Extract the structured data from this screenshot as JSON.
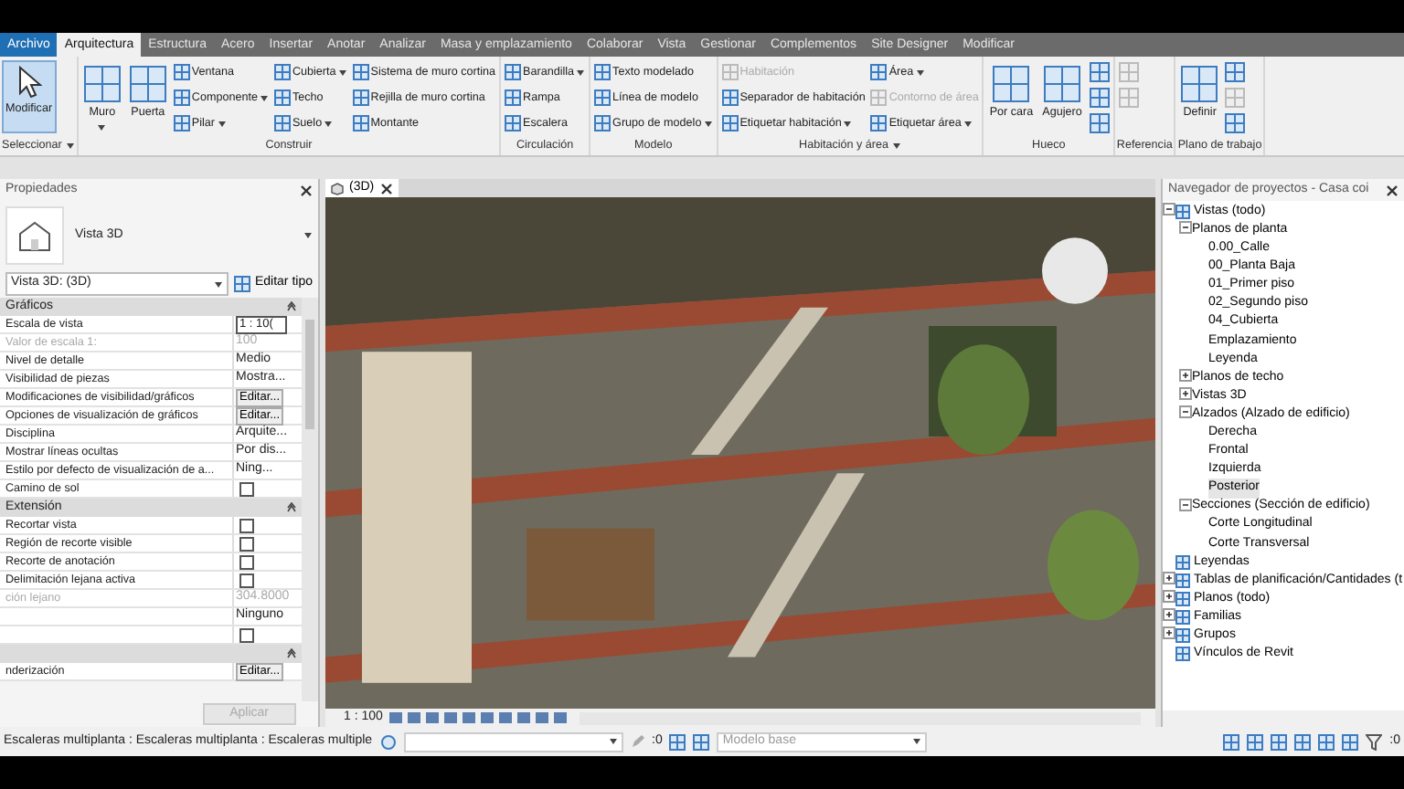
{
  "menu_tabs": [
    {
      "label": "Archivo",
      "kind": "file",
      "selected": false
    },
    {
      "label": "Arquitectura",
      "kind": "tab",
      "selected": true
    },
    {
      "label": "Estructura",
      "kind": "tab",
      "selected": false
    },
    {
      "label": "Acero",
      "kind": "tab",
      "selected": false
    },
    {
      "label": "Insertar",
      "kind": "tab",
      "selected": false
    },
    {
      "label": "Anotar",
      "kind": "tab",
      "selected": false
    },
    {
      "label": "Analizar",
      "kind": "tab",
      "selected": false
    },
    {
      "label": "Masa y emplazamiento",
      "kind": "tab",
      "selected": false
    },
    {
      "label": "Colaborar",
      "kind": "tab",
      "selected": false
    },
    {
      "label": "Vista",
      "kind": "tab",
      "selected": false
    },
    {
      "label": "Gestionar",
      "kind": "tab",
      "selected": false
    },
    {
      "label": "Complementos",
      "kind": "tab",
      "selected": false
    },
    {
      "label": "Site Designer",
      "kind": "tab",
      "selected": false
    },
    {
      "label": "Modificar",
      "kind": "tab",
      "selected": false
    }
  ],
  "ribbon": [
    {
      "title": "Seleccionar",
      "dropdown": true,
      "columns": [
        [
          {
            "label": "Modificar",
            "kind": "pointer",
            "pressed": true
          }
        ]
      ]
    },
    {
      "title": "Construir",
      "columns": [
        [
          {
            "label": "Muro",
            "kind": "large",
            "dropdown": true
          }
        ],
        [
          {
            "label": "Puerta",
            "kind": "large"
          }
        ],
        [
          {
            "label": "Ventana",
            "kind": "small"
          },
          {
            "label": "Componente",
            "kind": "small",
            "dropdown": true
          },
          {
            "label": "Pilar",
            "kind": "small",
            "dropdown": true
          }
        ],
        [
          {
            "label": "Cubierta",
            "kind": "small",
            "dropdown": true
          },
          {
            "label": "Techo",
            "kind": "small"
          },
          {
            "label": "Suelo",
            "kind": "small",
            "dropdown": true
          }
        ],
        [
          {
            "label": "Sistema de muro cortina",
            "kind": "small"
          },
          {
            "label": "Rejilla de muro cortina",
            "kind": "small"
          },
          {
            "label": "Montante",
            "kind": "small"
          }
        ]
      ]
    },
    {
      "title": "Circulación",
      "columns": [
        [
          {
            "label": "Barandilla",
            "kind": "small",
            "dropdown": true
          },
          {
            "label": "Rampa",
            "kind": "small"
          },
          {
            "label": "Escalera",
            "kind": "small"
          }
        ]
      ]
    },
    {
      "title": "Modelo",
      "columns": [
        [
          {
            "label": "Texto modelado",
            "kind": "small"
          },
          {
            "label": "Línea de modelo",
            "kind": "small"
          },
          {
            "label": "Grupo de modelo",
            "kind": "small",
            "dropdown": true
          }
        ]
      ]
    },
    {
      "title": "Habitación y área",
      "dropdown": true,
      "columns": [
        [
          {
            "label": "Habitación",
            "kind": "small",
            "disabled": true
          },
          {
            "label": "Separador de habitación",
            "kind": "small",
            "disabled": false
          },
          {
            "label": "Etiquetar habitación",
            "kind": "small",
            "dropdown": true,
            "disabled": false
          }
        ],
        [
          {
            "label": "Área",
            "kind": "small",
            "dropdown": true,
            "disabled": false
          },
          {
            "label": "Contorno de área",
            "kind": "small",
            "disabled": true
          },
          {
            "label": "Etiquetar área",
            "kind": "small",
            "dropdown": true,
            "disabled": false
          }
        ]
      ]
    },
    {
      "title": "Hueco",
      "columns": [
        [
          {
            "label": "Por cara",
            "kind": "large"
          }
        ],
        [
          {
            "label": "Agujero",
            "kind": "large"
          }
        ],
        [
          {
            "kind": "icon"
          },
          {
            "kind": "icon"
          },
          {
            "kind": "icon"
          }
        ]
      ]
    },
    {
      "title": "Referencia",
      "columns": [
        [
          {
            "kind": "icon",
            "disabled": true
          },
          {
            "kind": "icon",
            "disabled": true
          }
        ]
      ]
    },
    {
      "title": "Plano de trabajo",
      "columns": [
        [
          {
            "label": "Definir",
            "kind": "large"
          }
        ],
        [
          {
            "kind": "icon",
            "disabled": false
          },
          {
            "kind": "icon",
            "disabled": true
          },
          {
            "kind": "icon",
            "disabled": false
          }
        ]
      ]
    }
  ],
  "properties": {
    "title": "Propiedades",
    "type_name": "Vista 3D",
    "selector": "Vista 3D: (3D)",
    "edit_type": "Editar tipo",
    "groups": [
      {
        "title": "Gráficos",
        "rows": [
          {
            "label": "Escala de vista",
            "value": "1 : 10(",
            "kind": "input"
          },
          {
            "label": "Valor de escala   1:",
            "value": "100",
            "kind": "text",
            "disabled": true
          },
          {
            "label": "Nivel de detalle",
            "value": "Medio",
            "kind": "text"
          },
          {
            "label": "Visibilidad de piezas",
            "value": "Mostra...",
            "kind": "text"
          },
          {
            "label": "Modificaciones de visibilidad/gráficos",
            "value": "Editar...",
            "kind": "button"
          },
          {
            "label": "Opciones de visualización de gráficos",
            "value": "Editar...",
            "kind": "button"
          },
          {
            "label": "Disciplina",
            "value": "Arquite...",
            "kind": "text"
          },
          {
            "label": "Mostrar líneas ocultas",
            "value": "Por dis...",
            "kind": "text"
          },
          {
            "label": "Estilo por defecto de visualización de a...",
            "value": "Ning...",
            "kind": "text"
          },
          {
            "label": "Camino de sol",
            "kind": "checkbox",
            "checked": false
          }
        ]
      },
      {
        "title": "Extensión",
        "rows": [
          {
            "label": "Recortar vista",
            "kind": "checkbox",
            "checked": false
          },
          {
            "label": "Región de recorte visible",
            "kind": "checkbox",
            "checked": false
          },
          {
            "label": "Recorte de anotación",
            "kind": "checkbox",
            "checked": false
          },
          {
            "label": "Delimitación lejana activa",
            "kind": "checkbox",
            "checked": false
          },
          {
            "label": "ción lejano",
            "value": "304.8000",
            "kind": "text",
            "disabled": true
          },
          {
            "value": "Ninguno",
            "kind": "text"
          },
          {
            "kind": "checkbox",
            "checked": false
          }
        ]
      },
      {
        "rows": [
          {
            "label": "nderización",
            "value": "Editar...",
            "kind": "button"
          }
        ]
      }
    ],
    "apply": "Aplicar"
  },
  "view": {
    "tab": "(3D)",
    "scale": "1 : 100"
  },
  "browser": {
    "title": "Navegador de proyectos - Casa coi",
    "items": [
      {
        "label": "Vistas (todo)",
        "expanded": true,
        "children": [
          {
            "label": "Planos de planta",
            "expanded": true,
            "children": [
              {
                "label": "0.00_Calle"
              },
              {
                "label": "00_Planta Baja"
              },
              {
                "label": "01_Primer piso"
              },
              {
                "label": "02_Segundo piso"
              },
              {
                "label": "04_Cubierta"
              },
              {
                "label": "Emplazamiento"
              },
              {
                "label": "Leyenda"
              }
            ]
          },
          {
            "label": "Planos de techo",
            "expanded": false
          },
          {
            "label": "Vistas 3D",
            "expanded": false
          },
          {
            "label": "Alzados (Alzado de edificio)",
            "expanded": true,
            "children": [
              {
                "label": "Derecha",
                "selected": false
              },
              {
                "label": "Frontal",
                "selected": false
              },
              {
                "label": "Izquierda",
                "selected": false
              },
              {
                "label": "Posterior",
                "selected": true
              }
            ]
          },
          {
            "label": "Secciones (Sección de edificio)",
            "expanded": true,
            "children": [
              {
                "label": "Corte Longitudinal"
              },
              {
                "label": "Corte Transversal"
              }
            ]
          }
        ]
      },
      {
        "label": "Leyendas"
      },
      {
        "label": "Tablas de planificación/Cantidades (t",
        "expanded": false
      },
      {
        "label": "Planos (todo)",
        "expanded": false
      },
      {
        "label": "Familias",
        "expanded": false
      },
      {
        "label": "Grupos",
        "expanded": false
      },
      {
        "label": "Vínculos de Revit"
      }
    ]
  },
  "status_bar": {
    "message": "Escaleras multiplanta : Escaleras multiplanta : Escaleras multiple",
    "count_left": ":0",
    "model": "Modelo base",
    "count_right": ":0"
  }
}
